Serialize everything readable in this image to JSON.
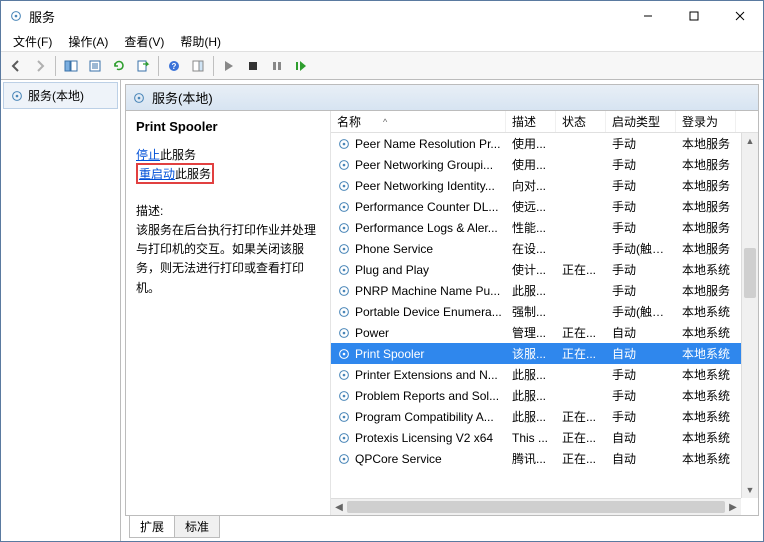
{
  "window": {
    "title": "服务"
  },
  "menu": {
    "file": "文件(F)",
    "action": "操作(A)",
    "view": "查看(V)",
    "help": "帮助(H)"
  },
  "nav": {
    "root": "服务(本地)"
  },
  "contentHeader": "服务(本地)",
  "details": {
    "title": "Print Spooler",
    "stopLink": "停止",
    "stopSuffix": "此服务",
    "restartLink": "重启动",
    "restartSuffix": "此服务",
    "descLabel": "描述:",
    "descText": "该服务在后台执行打印作业并处理与打印机的交互。如果关闭该服务，则无法进行打印或查看打印机。"
  },
  "columns": {
    "name": "名称",
    "desc": "描述",
    "status": "状态",
    "startup": "启动类型",
    "logon": "登录为"
  },
  "sortIndicator": "^",
  "services": [
    {
      "name": "Peer Name Resolution Pr...",
      "desc": "使用...",
      "status": "",
      "startup": "手动",
      "logon": "本地服务"
    },
    {
      "name": "Peer Networking Groupi...",
      "desc": "使用...",
      "status": "",
      "startup": "手动",
      "logon": "本地服务"
    },
    {
      "name": "Peer Networking Identity...",
      "desc": "向对...",
      "status": "",
      "startup": "手动",
      "logon": "本地服务"
    },
    {
      "name": "Performance Counter DL...",
      "desc": "使远...",
      "status": "",
      "startup": "手动",
      "logon": "本地服务"
    },
    {
      "name": "Performance Logs & Aler...",
      "desc": "性能...",
      "status": "",
      "startup": "手动",
      "logon": "本地服务"
    },
    {
      "name": "Phone Service",
      "desc": "在设...",
      "status": "",
      "startup": "手动(触发...",
      "logon": "本地服务"
    },
    {
      "name": "Plug and Play",
      "desc": "使计...",
      "status": "正在...",
      "startup": "手动",
      "logon": "本地系统"
    },
    {
      "name": "PNRP Machine Name Pu...",
      "desc": "此服...",
      "status": "",
      "startup": "手动",
      "logon": "本地服务"
    },
    {
      "name": "Portable Device Enumera...",
      "desc": "强制...",
      "status": "",
      "startup": "手动(触发...",
      "logon": "本地系统"
    },
    {
      "name": "Power",
      "desc": "管理...",
      "status": "正在...",
      "startup": "自动",
      "logon": "本地系统"
    },
    {
      "name": "Print Spooler",
      "desc": "该服...",
      "status": "正在...",
      "startup": "自动",
      "logon": "本地系统",
      "selected": true
    },
    {
      "name": "Printer Extensions and N...",
      "desc": "此服...",
      "status": "",
      "startup": "手动",
      "logon": "本地系统"
    },
    {
      "name": "Problem Reports and Sol...",
      "desc": "此服...",
      "status": "",
      "startup": "手动",
      "logon": "本地系统"
    },
    {
      "name": "Program Compatibility A...",
      "desc": "此服...",
      "status": "正在...",
      "startup": "手动",
      "logon": "本地系统"
    },
    {
      "name": "Protexis Licensing V2 x64",
      "desc": "This ...",
      "status": "正在...",
      "startup": "自动",
      "logon": "本地系统"
    },
    {
      "name": "QPCore Service",
      "desc": "腾讯...",
      "status": "正在...",
      "startup": "自动",
      "logon": "本地系统"
    }
  ],
  "tabs": {
    "extended": "扩展",
    "standard": "标准"
  }
}
